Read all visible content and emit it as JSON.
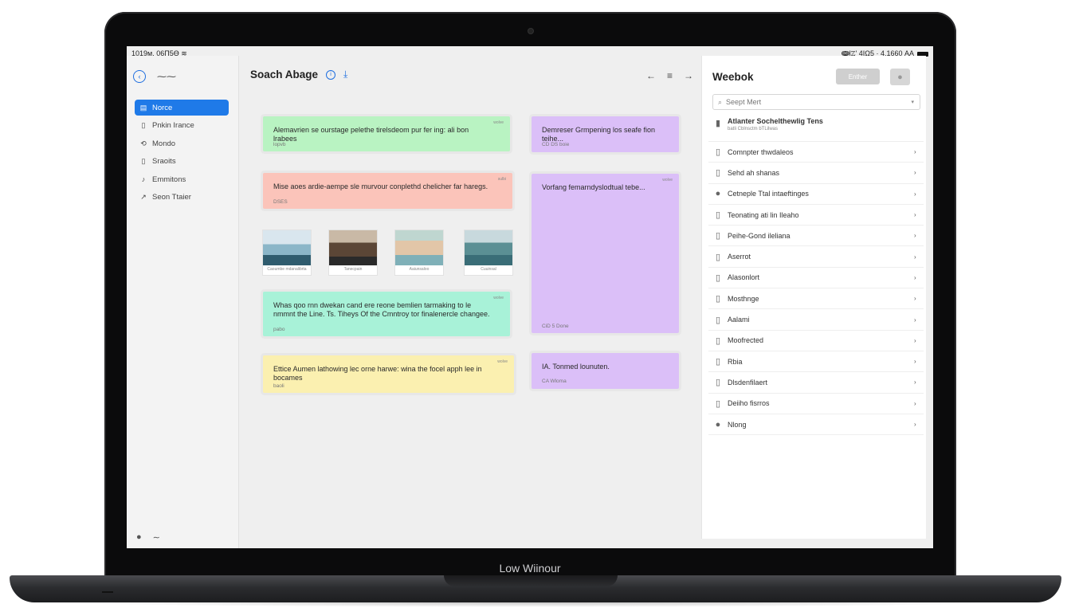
{
  "device": {
    "base_label": "Low Wiinour"
  },
  "statusbar": {
    "left": "1019м. 06П5Ө",
    "right": "ↈlℤ' 4ΙΩ5 · 4.1660 AA"
  },
  "sidebar": {
    "items": [
      {
        "label": "Norce",
        "icon": "notes-icon",
        "active": true
      },
      {
        "label": "Pnkin Irance",
        "icon": "document-icon",
        "active": false
      },
      {
        "label": "Mondo",
        "icon": "share-icon",
        "active": false
      },
      {
        "label": "Sraoits",
        "icon": "file-icon",
        "active": false
      },
      {
        "label": "Emmitons",
        "icon": "music-note-icon",
        "active": false
      },
      {
        "label": "Seon Ttaier",
        "icon": "chart-icon",
        "active": false
      }
    ]
  },
  "main": {
    "title": "Soach Abage",
    "cards": {
      "c1": {
        "text": "Alemavrien se ourstage pelethe tirelsdeom pur fer ing: ali bon lrabees",
        "foot": "lopvb",
        "tag": "wolve"
      },
      "c2": {
        "text": "Mise aoes ardie-aempe sle murvour conplethd chelicher far haregs.",
        "foot": "DSES",
        "tag": "sulbi"
      },
      "c3": {
        "text": "Whas qoo rnn dwekan cand ere reone bemlien tarmaking to le nmmnt the Line. Ts. Tiheys Of the Cmntroy tor finalenercle changee.",
        "foot": "pabo",
        "tag": "wolve"
      },
      "c4": {
        "text": "Ettice Aumen lathowing lec orne harwe: wina the focel apph lee in bocames",
        "foot": "baoli",
        "tag": "wolve"
      },
      "c5": {
        "text": "Demreser Grmpening los seafe fion teihe...",
        "foot": "CD DS boie",
        "tag": ""
      },
      "c6": {
        "text": "Vorfang femarndyslodtual tebe...",
        "foot": "CiD 5 Done",
        "tag": "wolve"
      },
      "c7": {
        "text": "IA. Tonmed lounuten.",
        "foot": "CA Wloma",
        "tag": ""
      }
    },
    "photos": [
      {
        "caption": "Caoumbe mdanalibrta"
      },
      {
        "caption": "Tanecpain"
      },
      {
        "caption": "Aaiunsaloo"
      },
      {
        "caption": "Cuuinsal"
      }
    ]
  },
  "right": {
    "title": "Weebok",
    "button": "Enther",
    "search_placeholder": "Seept Mert",
    "list": [
      {
        "label": "Atlanter Sochelthewlig Tens",
        "sub": "batli Cblnsctm bTLilwas",
        "icon": "device-icon"
      },
      {
        "label": "Comnpter thwdaleos",
        "icon": "device-icon"
      },
      {
        "label": "Sehd ah shanas",
        "icon": "device-icon"
      },
      {
        "label": "Cetneple Ttal intaeftinges",
        "icon": "user-icon"
      },
      {
        "label": "Teonating ati lin Ileaho",
        "icon": "device-icon"
      },
      {
        "label": "Peihe-Gond ileliana",
        "icon": "device-icon"
      },
      {
        "label": "Aserrot",
        "icon": "device-icon"
      },
      {
        "label": "Alasonlort",
        "icon": "device-icon"
      },
      {
        "label": "Mosthnge",
        "icon": "device-icon"
      },
      {
        "label": "Aalami",
        "icon": "device-icon"
      },
      {
        "label": "Moofrected",
        "icon": "device-icon"
      },
      {
        "label": "Rbia",
        "icon": "device-icon"
      },
      {
        "label": "Dlsdenfilaert",
        "icon": "device-icon"
      },
      {
        "label": "Deiiho fisrros",
        "icon": "device-icon"
      },
      {
        "label": "Nlong",
        "icon": "user-icon"
      }
    ]
  }
}
